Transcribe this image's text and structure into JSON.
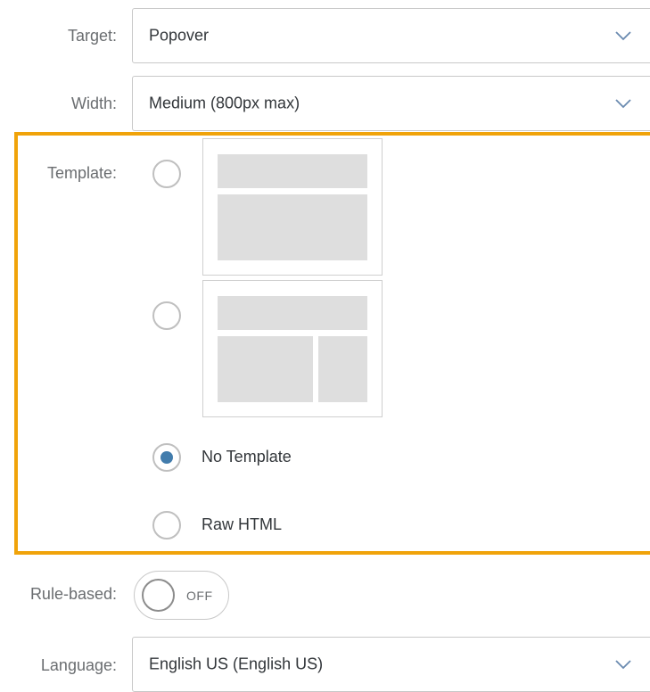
{
  "form": {
    "target": {
      "label": "Target:",
      "value": "Popover"
    },
    "width": {
      "label": "Width:",
      "value": "Medium (800px max)"
    },
    "template": {
      "label": "Template:",
      "options": [
        {
          "name": "header-content-layout",
          "selected": false
        },
        {
          "name": "header-two-column-layout",
          "selected": false
        },
        {
          "label": "No Template",
          "selected": true
        },
        {
          "label": "Raw HTML",
          "selected": false
        }
      ]
    },
    "rule_based": {
      "label": "Rule-based:",
      "state": "OFF"
    },
    "language": {
      "label": "Language:",
      "value": "English US (English US)"
    }
  },
  "colors": {
    "highlight": "#f0a30a",
    "radio_selected": "#427cac",
    "label": "#6a6d70",
    "text": "#32363a"
  },
  "icons": {
    "dropdown": "chevron-down-icon"
  }
}
